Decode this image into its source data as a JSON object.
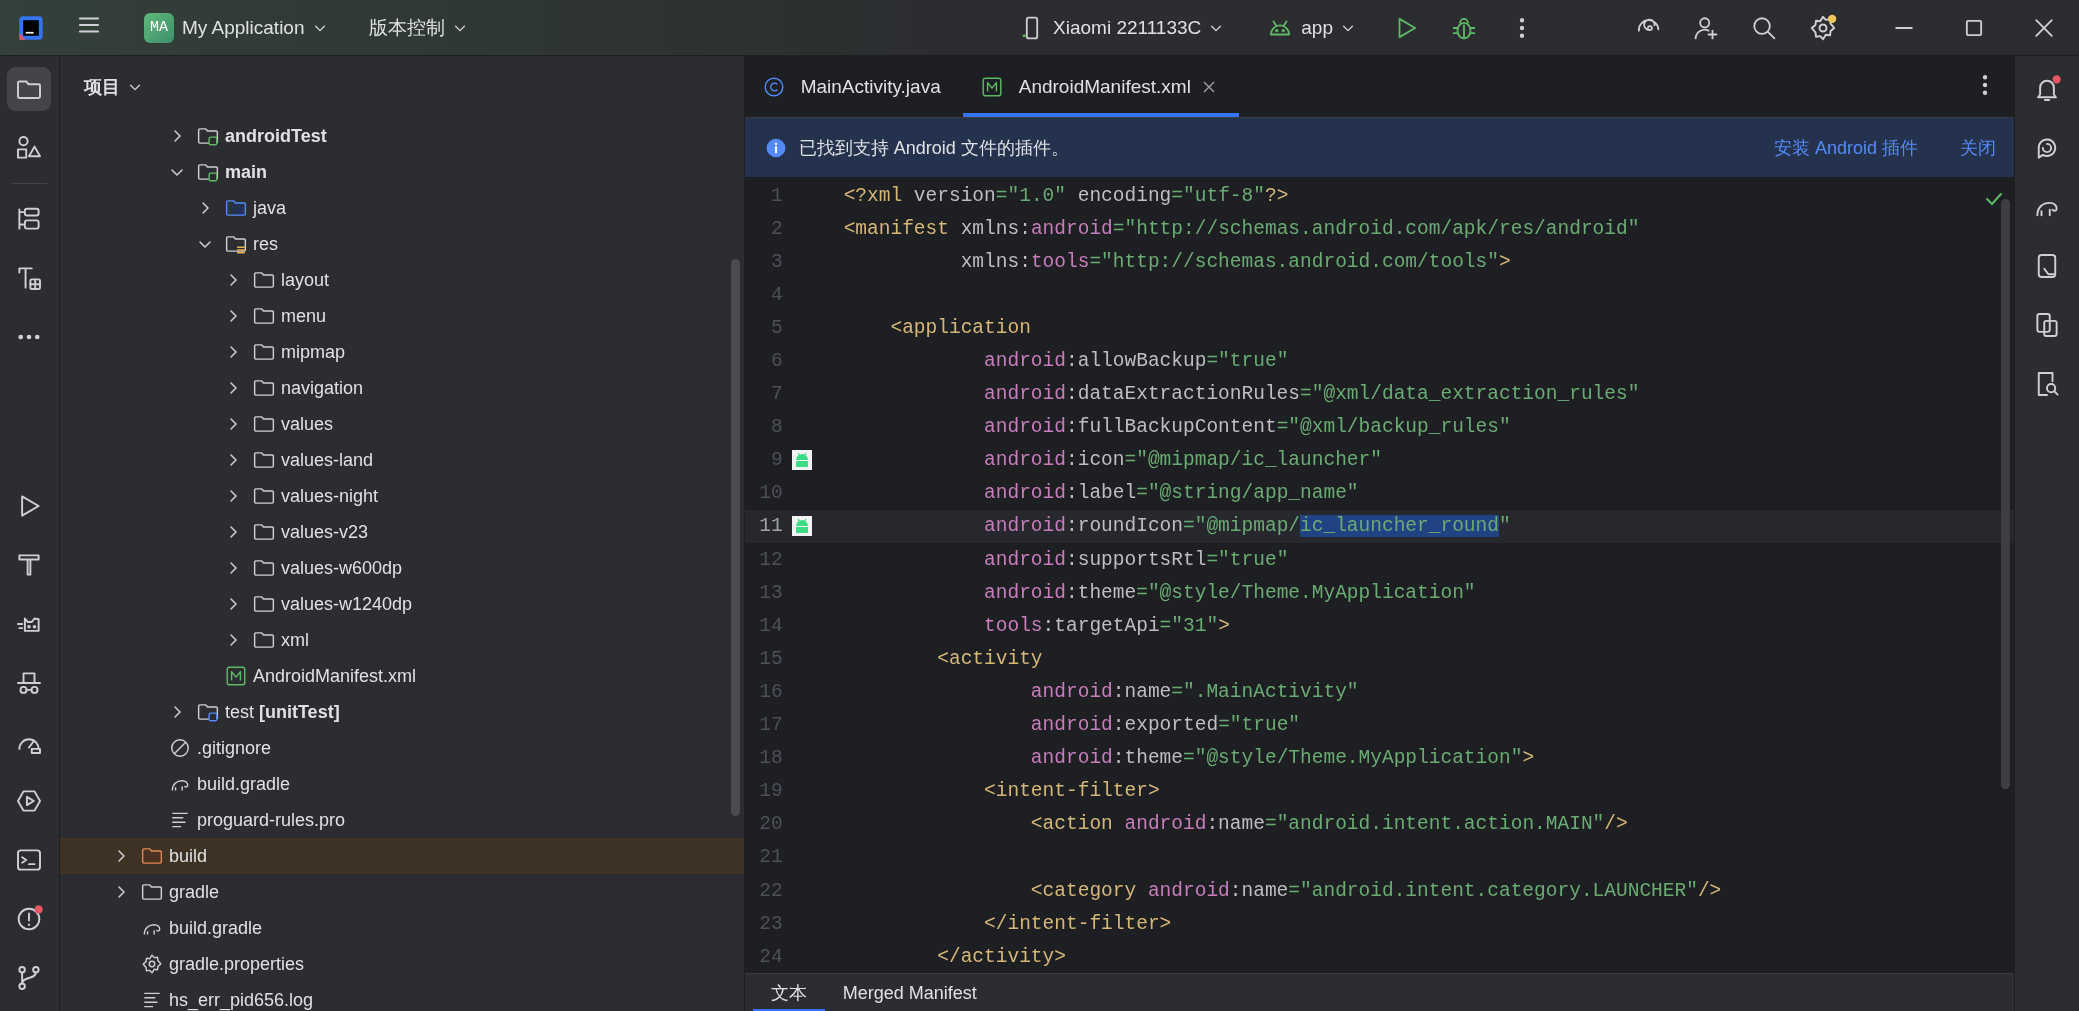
{
  "title_bar": {
    "project_badge": "MA",
    "project": "My Application",
    "vcs": "版本控制",
    "device": "Xiaomi 2211133C",
    "run_config": "app",
    "settings_notified": true
  },
  "left_toolbar": {
    "top": [
      {
        "kind": "project",
        "selected": true,
        "notified": false
      },
      {
        "kind": "resource-manager",
        "selected": false,
        "notified": false
      },
      {
        "kind": "structure",
        "selected": false,
        "notified": false
      },
      {
        "kind": "build-variants",
        "selected": false,
        "notified": false
      },
      {
        "kind": "more",
        "selected": false,
        "notified": false
      }
    ],
    "bottom": [
      {
        "kind": "run",
        "selected": false,
        "notified": false
      },
      {
        "kind": "build",
        "selected": false,
        "notified": false
      },
      {
        "kind": "logcat",
        "selected": false,
        "notified": false
      },
      {
        "kind": "inspection",
        "selected": false,
        "notified": false
      },
      {
        "kind": "profiler",
        "selected": false,
        "notified": false
      },
      {
        "kind": "running-devices",
        "selected": false,
        "notified": false
      },
      {
        "kind": "terminal",
        "selected": false,
        "notified": false
      },
      {
        "kind": "problems",
        "selected": false,
        "notified": true
      },
      {
        "kind": "git",
        "selected": false,
        "notified": false
      }
    ]
  },
  "project_panel": {
    "title": "项目",
    "tree": [
      {
        "children": [
          {
            "children": [
              {
                "label": "androidTest",
                "kind": "module-folder",
                "bold": true,
                "selected": false,
                "expanded": false
              },
              {
                "label": "main",
                "kind": "module-folder",
                "bold": true,
                "selected": false,
                "expanded": true,
                "children": [
                  {
                    "label": "java",
                    "kind": "source-folder",
                    "bold": false,
                    "selected": false,
                    "expanded": false
                  },
                  {
                    "label": "res",
                    "kind": "resource-folder",
                    "bold": false,
                    "selected": false,
                    "expanded": true,
                    "children": [
                      {
                        "label": "layout",
                        "kind": "folder",
                        "bold": false,
                        "selected": false,
                        "expanded": false
                      },
                      {
                        "label": "menu",
                        "kind": "folder",
                        "bold": false,
                        "selected": false,
                        "expanded": false
                      },
                      {
                        "label": "mipmap",
                        "kind": "folder",
                        "bold": false,
                        "selected": false,
                        "expanded": false
                      },
                      {
                        "label": "navigation",
                        "kind": "folder",
                        "bold": false,
                        "selected": false,
                        "expanded": false
                      },
                      {
                        "label": "values",
                        "kind": "folder",
                        "bold": false,
                        "selected": false,
                        "expanded": false
                      },
                      {
                        "label": "values-land",
                        "kind": "folder",
                        "bold": false,
                        "selected": false,
                        "expanded": false
                      },
                      {
                        "label": "values-night",
                        "kind": "folder",
                        "bold": false,
                        "selected": false,
                        "expanded": false
                      },
                      {
                        "label": "values-v23",
                        "kind": "folder",
                        "bold": false,
                        "selected": false,
                        "expanded": false
                      },
                      {
                        "label": "values-w600dp",
                        "kind": "folder",
                        "bold": false,
                        "selected": false,
                        "expanded": false
                      },
                      {
                        "label": "values-w1240dp",
                        "kind": "folder",
                        "bold": false,
                        "selected": false,
                        "expanded": false
                      },
                      {
                        "label": "xml",
                        "kind": "folder",
                        "bold": false,
                        "selected": false,
                        "expanded": false
                      }
                    ]
                  },
                  {
                    "label": "AndroidManifest.xml",
                    "kind": "manifest",
                    "bold": false,
                    "selected": false
                  }
                ]
              },
              {
                "label": "test **[unitTest]**",
                "kind": "test-folder",
                "bold": false,
                "selected": false,
                "expanded": false
              }
            ]
          },
          {
            "label": ".gitignore",
            "kind": "ignore",
            "bold": false,
            "selected": false
          },
          {
            "label": "build.gradle",
            "kind": "gradle",
            "bold": false,
            "selected": false
          },
          {
            "label": "proguard-rules.pro",
            "kind": "text-file",
            "bold": false,
            "selected": false
          }
        ]
      },
      {
        "label": "build",
        "kind": "excluded-folder",
        "bold": false,
        "selected": true,
        "expanded": false
      },
      {
        "label": "gradle",
        "kind": "folder",
        "bold": false,
        "selected": false,
        "expanded": false
      },
      {
        "label": "build.gradle",
        "kind": "gradle",
        "bold": false,
        "selected": false
      },
      {
        "label": "gradle.properties",
        "kind": "settings-file",
        "bold": false,
        "selected": false
      },
      {
        "label": "hs_err_pid656.log",
        "kind": "text-file",
        "bold": false,
        "selected": false
      }
    ]
  },
  "editor": {
    "tabs": [
      {
        "label": "MainActivity.java",
        "kind": "java-class",
        "selected": false,
        "closable": false
      },
      {
        "label": "AndroidManifest.xml",
        "kind": "manifest",
        "selected": true,
        "closable": true
      }
    ],
    "banner": {
      "message": "已找到支持 Android 文件的插件。",
      "actions": [
        "安装 Android 插件",
        "关闭"
      ]
    },
    "lines": [
      {
        "number": "1",
        "kind": "plain",
        "current": false,
        "segments": [
          {
            "kind": "tag",
            "text": "<?xml"
          },
          {
            "kind": "attr",
            "text": " version"
          },
          {
            "kind": "value",
            "text": "=\"1.0\""
          },
          {
            "kind": "attr",
            "text": " encoding"
          },
          {
            "kind": "value",
            "text": "=\"utf-8\""
          },
          {
            "kind": "tag",
            "text": "?>"
          }
        ]
      },
      {
        "number": "2",
        "kind": "plain",
        "current": false,
        "segments": [
          {
            "kind": "tag",
            "text": "<manifest"
          },
          {
            "kind": "attr",
            "text": " xmlns:"
          },
          {
            "kind": "ns",
            "text": "android"
          },
          {
            "kind": "value",
            "text": "=\"http://schemas.android.com/apk/res/android\""
          }
        ]
      },
      {
        "number": "3",
        "kind": "plain",
        "current": false,
        "segments": [
          {
            "kind": "attr",
            "text": "          xmlns:"
          },
          {
            "kind": "ns",
            "text": "tools"
          },
          {
            "kind": "value",
            "text": "=\"http://schemas.android.com/tools\""
          },
          {
            "kind": "tag",
            "text": ">"
          }
        ]
      },
      {
        "number": "4",
        "kind": "plain",
        "current": false
      },
      {
        "number": "5",
        "kind": "plain",
        "current": false,
        "segments": [
          {
            "kind": "tag",
            "text": "    <application"
          }
        ]
      },
      {
        "number": "6",
        "kind": "plain",
        "current": false,
        "segments": [
          {
            "kind": "ns",
            "text": "            android"
          },
          {
            "kind": "attr",
            "text": ":allowBackup"
          },
          {
            "kind": "value",
            "text": "=\"true\""
          }
        ]
      },
      {
        "number": "7",
        "kind": "plain",
        "current": false,
        "segments": [
          {
            "kind": "ns",
            "text": "            android"
          },
          {
            "kind": "attr",
            "text": ":dataExtractionRules"
          },
          {
            "kind": "value",
            "text": "=\"@xml/data_extraction_rules\""
          }
        ]
      },
      {
        "number": "8",
        "kind": "plain",
        "current": false,
        "segments": [
          {
            "kind": "ns",
            "text": "            android"
          },
          {
            "kind": "attr",
            "text": ":fullBackupContent"
          },
          {
            "kind": "value",
            "text": "=\"@xml/backup_rules\""
          }
        ]
      },
      {
        "number": "9",
        "kind": "marked",
        "current": false,
        "segments": [
          {
            "kind": "ns",
            "text": "            android"
          },
          {
            "kind": "attr",
            "text": ":icon"
          },
          {
            "kind": "value",
            "text": "=\"@mipmap/ic_launcher\""
          }
        ]
      },
      {
        "number": "10",
        "kind": "plain",
        "current": false,
        "segments": [
          {
            "kind": "ns",
            "text": "            android"
          },
          {
            "kind": "attr",
            "text": ":label"
          },
          {
            "kind": "value",
            "text": "=\"@string/app_name\""
          }
        ]
      },
      {
        "number": "11",
        "kind": "marked",
        "current": true,
        "segments": [
          {
            "kind": "ns",
            "text": "            android"
          },
          {
            "kind": "attr",
            "text": ":roundIcon"
          },
          {
            "kind": "value",
            "text": "=\"@mipmap/"
          },
          {
            "kind": "selection",
            "text": "ic_launcher_round"
          },
          {
            "kind": "value",
            "text": "\""
          }
        ]
      },
      {
        "number": "12",
        "kind": "plain",
        "current": false,
        "segments": [
          {
            "kind": "ns",
            "text": "            android"
          },
          {
            "kind": "attr",
            "text": ":supportsRtl"
          },
          {
            "kind": "value",
            "text": "=\"true\""
          }
        ]
      },
      {
        "number": "13",
        "kind": "plain",
        "current": false,
        "segments": [
          {
            "kind": "ns",
            "text": "            android"
          },
          {
            "kind": "attr",
            "text": ":theme"
          },
          {
            "kind": "value",
            "text": "=\"@style/Theme.MyApplication\""
          }
        ]
      },
      {
        "number": "14",
        "kind": "plain",
        "current": false,
        "segments": [
          {
            "kind": "ns",
            "text": "            tools"
          },
          {
            "kind": "attr",
            "text": ":targetApi"
          },
          {
            "kind": "value",
            "text": "=\"31\""
          },
          {
            "kind": "tag",
            "text": ">"
          }
        ]
      },
      {
        "number": "15",
        "kind": "plain",
        "current": false,
        "segments": [
          {
            "kind": "tag",
            "text": "        <activity"
          }
        ]
      },
      {
        "number": "16",
        "kind": "plain",
        "current": false,
        "segments": [
          {
            "kind": "ns",
            "text": "                android"
          },
          {
            "kind": "attr",
            "text": ":name"
          },
          {
            "kind": "value",
            "text": "=\".MainActivity\""
          }
        ]
      },
      {
        "number": "17",
        "kind": "plain",
        "current": false,
        "segments": [
          {
            "kind": "ns",
            "text": "                android"
          },
          {
            "kind": "attr",
            "text": ":exported"
          },
          {
            "kind": "value",
            "text": "=\"true\""
          }
        ]
      },
      {
        "number": "18",
        "kind": "plain",
        "current": false,
        "segments": [
          {
            "kind": "ns",
            "text": "                android"
          },
          {
            "kind": "attr",
            "text": ":theme"
          },
          {
            "kind": "value",
            "text": "=\"@style/Theme.MyApplication\""
          },
          {
            "kind": "tag",
            "text": ">"
          }
        ]
      },
      {
        "number": "19",
        "kind": "plain",
        "current": false,
        "segments": [
          {
            "kind": "tag",
            "text": "            <intent-filter>"
          }
        ]
      },
      {
        "number": "20",
        "kind": "plain",
        "current": false,
        "segments": [
          {
            "kind": "tag",
            "text": "                <action "
          },
          {
            "kind": "ns",
            "text": "android"
          },
          {
            "kind": "attr",
            "text": ":name"
          },
          {
            "kind": "value",
            "text": "=\"android.intent.action.MAIN\""
          },
          {
            "kind": "tag",
            "text": "/>"
          }
        ]
      },
      {
        "number": "21",
        "kind": "plain",
        "current": false
      },
      {
        "number": "22",
        "kind": "plain",
        "current": false,
        "segments": [
          {
            "kind": "tag",
            "text": "                <category "
          },
          {
            "kind": "ns",
            "text": "android"
          },
          {
            "kind": "attr",
            "text": ":name"
          },
          {
            "kind": "value",
            "text": "=\"android.intent.category.LAUNCHER\""
          },
          {
            "kind": "tag",
            "text": "/>"
          }
        ]
      },
      {
        "number": "23",
        "kind": "plain",
        "current": false,
        "segments": [
          {
            "kind": "tag",
            "text": "            </intent-filter>"
          }
        ]
      },
      {
        "number": "24",
        "kind": "plain",
        "current": false,
        "segments": [
          {
            "kind": "tag",
            "text": "        </activity>"
          }
        ]
      }
    ],
    "bottom_tabs": [
      {
        "label": "文本",
        "selected": true
      },
      {
        "label": "Merged Manifest",
        "selected": false
      }
    ]
  },
  "right_toolbar": [
    {
      "kind": "notifications",
      "notified": true
    },
    {
      "kind": "assistant",
      "notified": false
    },
    {
      "kind": "gradle",
      "notified": false
    },
    {
      "kind": "device-explorer",
      "notified": false
    },
    {
      "kind": "device-manager",
      "notified": false
    },
    {
      "kind": "file-search",
      "notified": false
    }
  ]
}
